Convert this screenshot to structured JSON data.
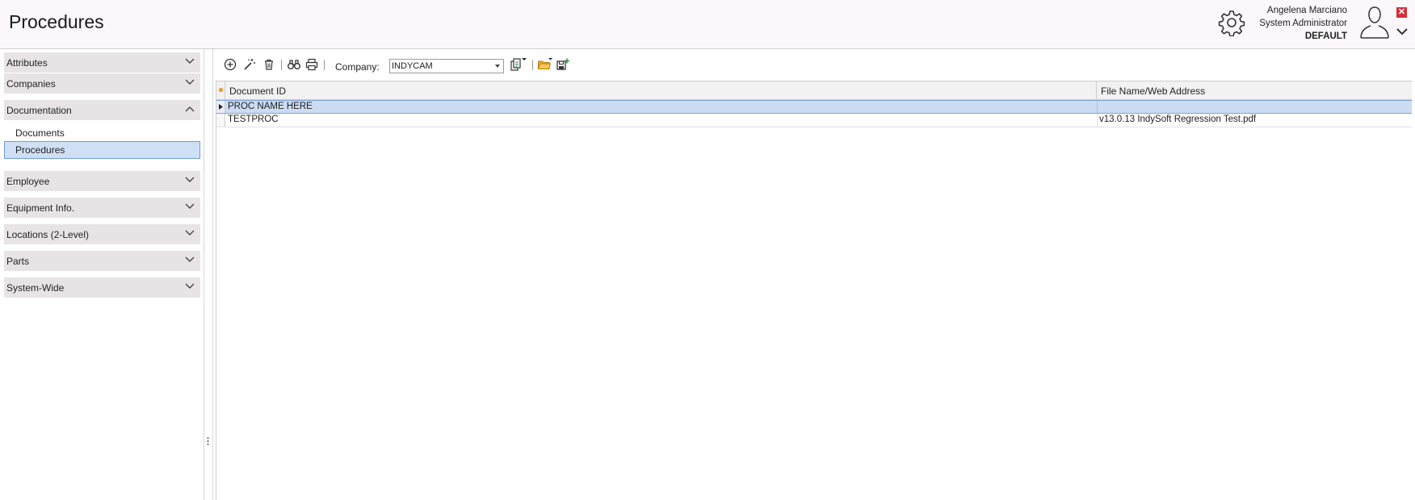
{
  "header": {
    "title": "Procedures",
    "user": {
      "name": "Angelena Marciano",
      "role": "System Administrator",
      "database": "DEFAULT"
    },
    "icons": [
      "gear-icon",
      "user-avatar-icon",
      "close-icon",
      "chevron-down-icon"
    ]
  },
  "sidebar": {
    "groups": [
      {
        "label": "Attributes",
        "expanded": false
      },
      {
        "label": "Companies",
        "expanded": false
      },
      {
        "label": "Documentation",
        "expanded": true,
        "items": [
          {
            "label": "Documents",
            "selected": false
          },
          {
            "label": "Procedures",
            "selected": true
          }
        ]
      },
      {
        "label": "Employee",
        "expanded": false
      },
      {
        "label": "Equipment Info.",
        "expanded": false
      },
      {
        "label": "Locations (2-Level)",
        "expanded": false
      },
      {
        "label": "Parts",
        "expanded": false
      },
      {
        "label": "System-Wide",
        "expanded": false
      }
    ]
  },
  "toolbar": {
    "buttons": [
      "add-icon",
      "edit-wand-icon",
      "delete-icon",
      "find-binoculars-icon",
      "print-icon",
      "copy-menu-icon",
      "open-folder-icon",
      "save-add-icon"
    ],
    "company_label": "Company:",
    "company_value": "INDYCAM"
  },
  "grid": {
    "columns": [
      "Document ID",
      "File Name/Web Address"
    ],
    "rows": [
      {
        "document_id": "PROC NAME HERE",
        "file": "",
        "selected": true
      },
      {
        "document_id": "TESTPROC",
        "file": "v13.0.13 IndySoft Regression Test.pdf",
        "selected": false
      }
    ]
  },
  "colors": {
    "header_bg": "#fcf7fa",
    "nav_group_bg": "#e8e4e6",
    "selection_bg": "#cfe0f6",
    "selection_border": "#6e9cd3",
    "close_red": "#d62f3a",
    "new_row_marker": "#f29a2e"
  }
}
